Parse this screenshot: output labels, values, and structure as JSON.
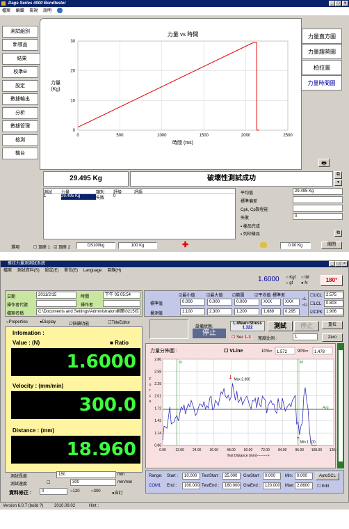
{
  "win1": {
    "title": "Dage Series 4000 Bondtester",
    "menu": [
      "檔案",
      "編輯",
      "檢視",
      "說明"
    ],
    "nav": [
      "測試組別",
      "新樣品",
      "結果",
      "校準Θ",
      "設定",
      "數據輸出",
      "分析",
      "數據管理",
      "檢測",
      "機台"
    ],
    "tabs": [
      "力量直方圖",
      "力量趨勢圖",
      "柏拉圖",
      "力量時間圖"
    ],
    "chart_data": {
      "type": "line",
      "title": "力量 vs 時間",
      "xlabel": "時間 (ms)",
      "ylabel": "力量 (Kg)",
      "xlim": [
        0,
        2500
      ],
      "ylim": [
        0,
        30
      ],
      "xticks": [
        "0",
        "500",
        "1000",
        "1500",
        "2000",
        "2500"
      ],
      "yticks": [
        "0",
        "10",
        "20",
        "30"
      ],
      "x": [
        0,
        2090,
        2130,
        2131,
        2160
      ],
      "y": [
        1,
        29.5,
        29.5,
        0,
        0
      ]
    },
    "force_value": "29.495 Kg",
    "result_text": "破壞性測試成功",
    "table_headers": [
      "測試",
      "力量",
      "類別",
      "評級",
      "評語"
    ],
    "table_row": [
      "1",
      "29.495 Kg",
      "失敗",
      "0",
      ""
    ],
    "stats": [
      {
        "label": "平均值",
        "value": "29.495 Kg"
      },
      {
        "label": "標準偏差",
        "value": ""
      },
      {
        "label": "Cpk, Cp製程能",
        "value": ""
      },
      {
        "label": "失敗",
        "value": "0"
      }
    ],
    "save_sample": "樣品完成",
    "print_sample": "列印樣品",
    "bottom": {
      "options": "選項",
      "probe1": "頂座 1",
      "probe2": "頂座 2",
      "cartridge": "DS100kg",
      "load": "100 Kg",
      "reading": "0.00 Kg",
      "close": "關閉"
    }
  },
  "win2": {
    "title": "推拉力量測測試系統",
    "menu": [
      "檔案",
      "測試資料(S)",
      "設定(E)",
      "單位(E)",
      "Language",
      "目錄(H)"
    ],
    "top_value": "1.6000",
    "units": [
      "Kgf",
      "lbf",
      "gf",
      "N"
    ],
    "badge": "180°",
    "date_label": "日期",
    "date": "2011/2/15",
    "time_label": "時間",
    "time": "下午 05:05:54",
    "op_label": "操作者代號",
    "op2_label": "操作者",
    "file_label": "檔案名稱",
    "file": "C:\\Documents and Settings\\Administrator\\桌面\\0215拉",
    "stat_checks": [
      "最小值",
      "最大值",
      "範圍",
      "平均值",
      "標準差"
    ],
    "row1_label": "標準值",
    "row1": [
      "0.000",
      "0.000",
      "0.000",
      "XXX",
      "XXX"
    ],
    "row2_label": "量測值",
    "row2": [
      "1.100",
      "2.300",
      "1.200",
      "1.689",
      "0.295"
    ],
    "lu": [
      "L",
      "U"
    ],
    "ucl": [
      {
        "label": "UCL",
        "value": "2.575"
      },
      {
        "label": "LCL",
        "value": "0.803"
      },
      {
        "label": "CPK",
        "value": "1.906"
      }
    ],
    "opts": [
      "Properties",
      "Display",
      "快讀功能",
      "TitleEditor"
    ],
    "state_label": "設備狀態:",
    "state": "停止",
    "mode": "L-Mean-Stress",
    "mode_value": "1.322",
    "btn_test": "測試",
    "btn_stop": "停止",
    "btn_reset": "重拉",
    "btn_zero": "Zero",
    "sec": "Sec 1-3",
    "width_label": "寬度比例 :",
    "width_value": "1",
    "info_title": "Infomation :",
    "ratio": "Ratio",
    "value_label": "Value : (N)",
    "value": "1.6000",
    "vel_label": "Velocity : (mm/min)",
    "vel": "300.0",
    "dist_label": "Distance : (mm)",
    "dist": "18.960",
    "len_label": "測試長度",
    "len": "150",
    "len_unit": "mm",
    "spd_label": "測試速度",
    "spd": "300",
    "spd_unit": "mm/min",
    "corr_label": "資料修正 :",
    "corr": "0",
    "spd_opts": [
      "120",
      "300",
      "自訂"
    ],
    "chart_data": {
      "type": "line",
      "title": "力量分佈圖 :",
      "xlabel": "Test Distance (mm)--------->",
      "ylabel": "Force",
      "vline": "VLine",
      "p10_label": "10%=",
      "p10": "1.572",
      "p90_label": "90%=",
      "p90": "1.478",
      "xlim": [
        0,
        120
      ],
      "ylim": [
        0.85,
        2.86
      ],
      "xticks": [
        "0.00",
        "12.00",
        "24.00",
        "36.00",
        "48.00",
        "60.00",
        "72.00",
        "84.00",
        "96.00",
        "108.00",
        "120.0"
      ],
      "yticks": [
        "2.86",
        "2.58",
        "2.29",
        "2.01",
        "1.72",
        "1.43",
        "1.14",
        "0.86"
      ],
      "avg": 1.689,
      "avg_label": "Avg",
      "max_label": "Max 2.300",
      "min_label": "Min 1.100",
      "mark_lo": "10",
      "mark_hi": "90",
      "x": [
        0,
        1,
        2,
        3,
        4,
        5,
        6,
        8,
        9,
        10,
        11,
        12,
        13,
        14,
        15,
        16,
        17,
        18,
        19,
        20,
        21,
        22,
        23,
        24,
        25,
        26,
        27,
        28,
        29,
        30,
        31,
        32,
        33,
        34,
        35,
        36,
        37,
        38,
        39,
        40,
        41,
        42,
        43,
        44,
        45,
        46,
        47,
        48,
        49,
        50,
        51,
        52,
        53,
        54,
        55,
        56,
        57,
        58,
        59,
        60,
        61,
        62,
        63,
        64,
        65,
        66,
        67,
        68,
        69,
        70,
        71,
        72,
        73,
        74,
        75,
        76,
        77,
        78,
        79,
        80,
        81,
        82,
        83,
        84,
        85,
        86,
        87,
        88,
        89,
        90,
        91,
        92,
        93,
        94,
        95,
        96,
        97,
        98,
        99,
        100,
        101,
        102,
        103,
        104,
        105,
        106,
        107,
        108
      ],
      "y": [
        0.98,
        1.3,
        1.28,
        1.25,
        1.5,
        1.75,
        1.35,
        1.4,
        1.5,
        1.55,
        1.42,
        1.6,
        1.75,
        1.7,
        1.8,
        1.58,
        1.72,
        1.82,
        1.75,
        1.9,
        1.8,
        1.7,
        1.55,
        1.6,
        1.72,
        1.82,
        1.8,
        1.75,
        1.88,
        1.7,
        1.78,
        1.72,
        1.95,
        2.0,
        1.68,
        1.72,
        1.9,
        1.85,
        1.78,
        1.95,
        2.1,
        2.05,
        2.18,
        2.0,
        1.95,
        2.02,
        1.9,
        1.98,
        2.3,
        2.1,
        1.9,
        2.12,
        1.85,
        1.9,
        1.98,
        1.8,
        1.88,
        1.95,
        2.0,
        1.9,
        1.78,
        1.7,
        1.9,
        1.88,
        1.95,
        1.72,
        1.98,
        1.8,
        1.75,
        2.0,
        1.95,
        1.9,
        1.6,
        1.78,
        1.85,
        1.9,
        1.8,
        1.82,
        1.65,
        1.6,
        1.95,
        1.75,
        1.7,
        1.95,
        1.8,
        1.65,
        1.72,
        1.78,
        1.82,
        1.75,
        1.9,
        1.95,
        2.02,
        1.35,
        1.4,
        1.1,
        1.3,
        1.38,
        2.0,
        2.2,
        1.9,
        1.7,
        1.2,
        0.9,
        0.86,
        0.86,
        0.86,
        0.86
      ]
    },
    "range_rows": [
      {
        "a": "Range:",
        "b": "Start :",
        "bv": "10.000",
        "c": "TestStart :",
        "cv": "25.000",
        "d": "GraStart :",
        "dv": "0.000",
        "e": "Min:",
        "ev": "0.000",
        "f": "AutoSCL"
      },
      {
        "a": "COM1",
        "b": "End :",
        "bv": "100.000",
        "c": "TestEnd :",
        "cv": "160.000",
        "d": "GraEnd :",
        "dv": "120.000",
        "e": "Max:",
        "ev": "2.8600",
        "f": "Edit"
      }
    ],
    "status": [
      "Version 6.0.7  (build ?)",
      "2010.09.02",
      "Hint :"
    ]
  }
}
